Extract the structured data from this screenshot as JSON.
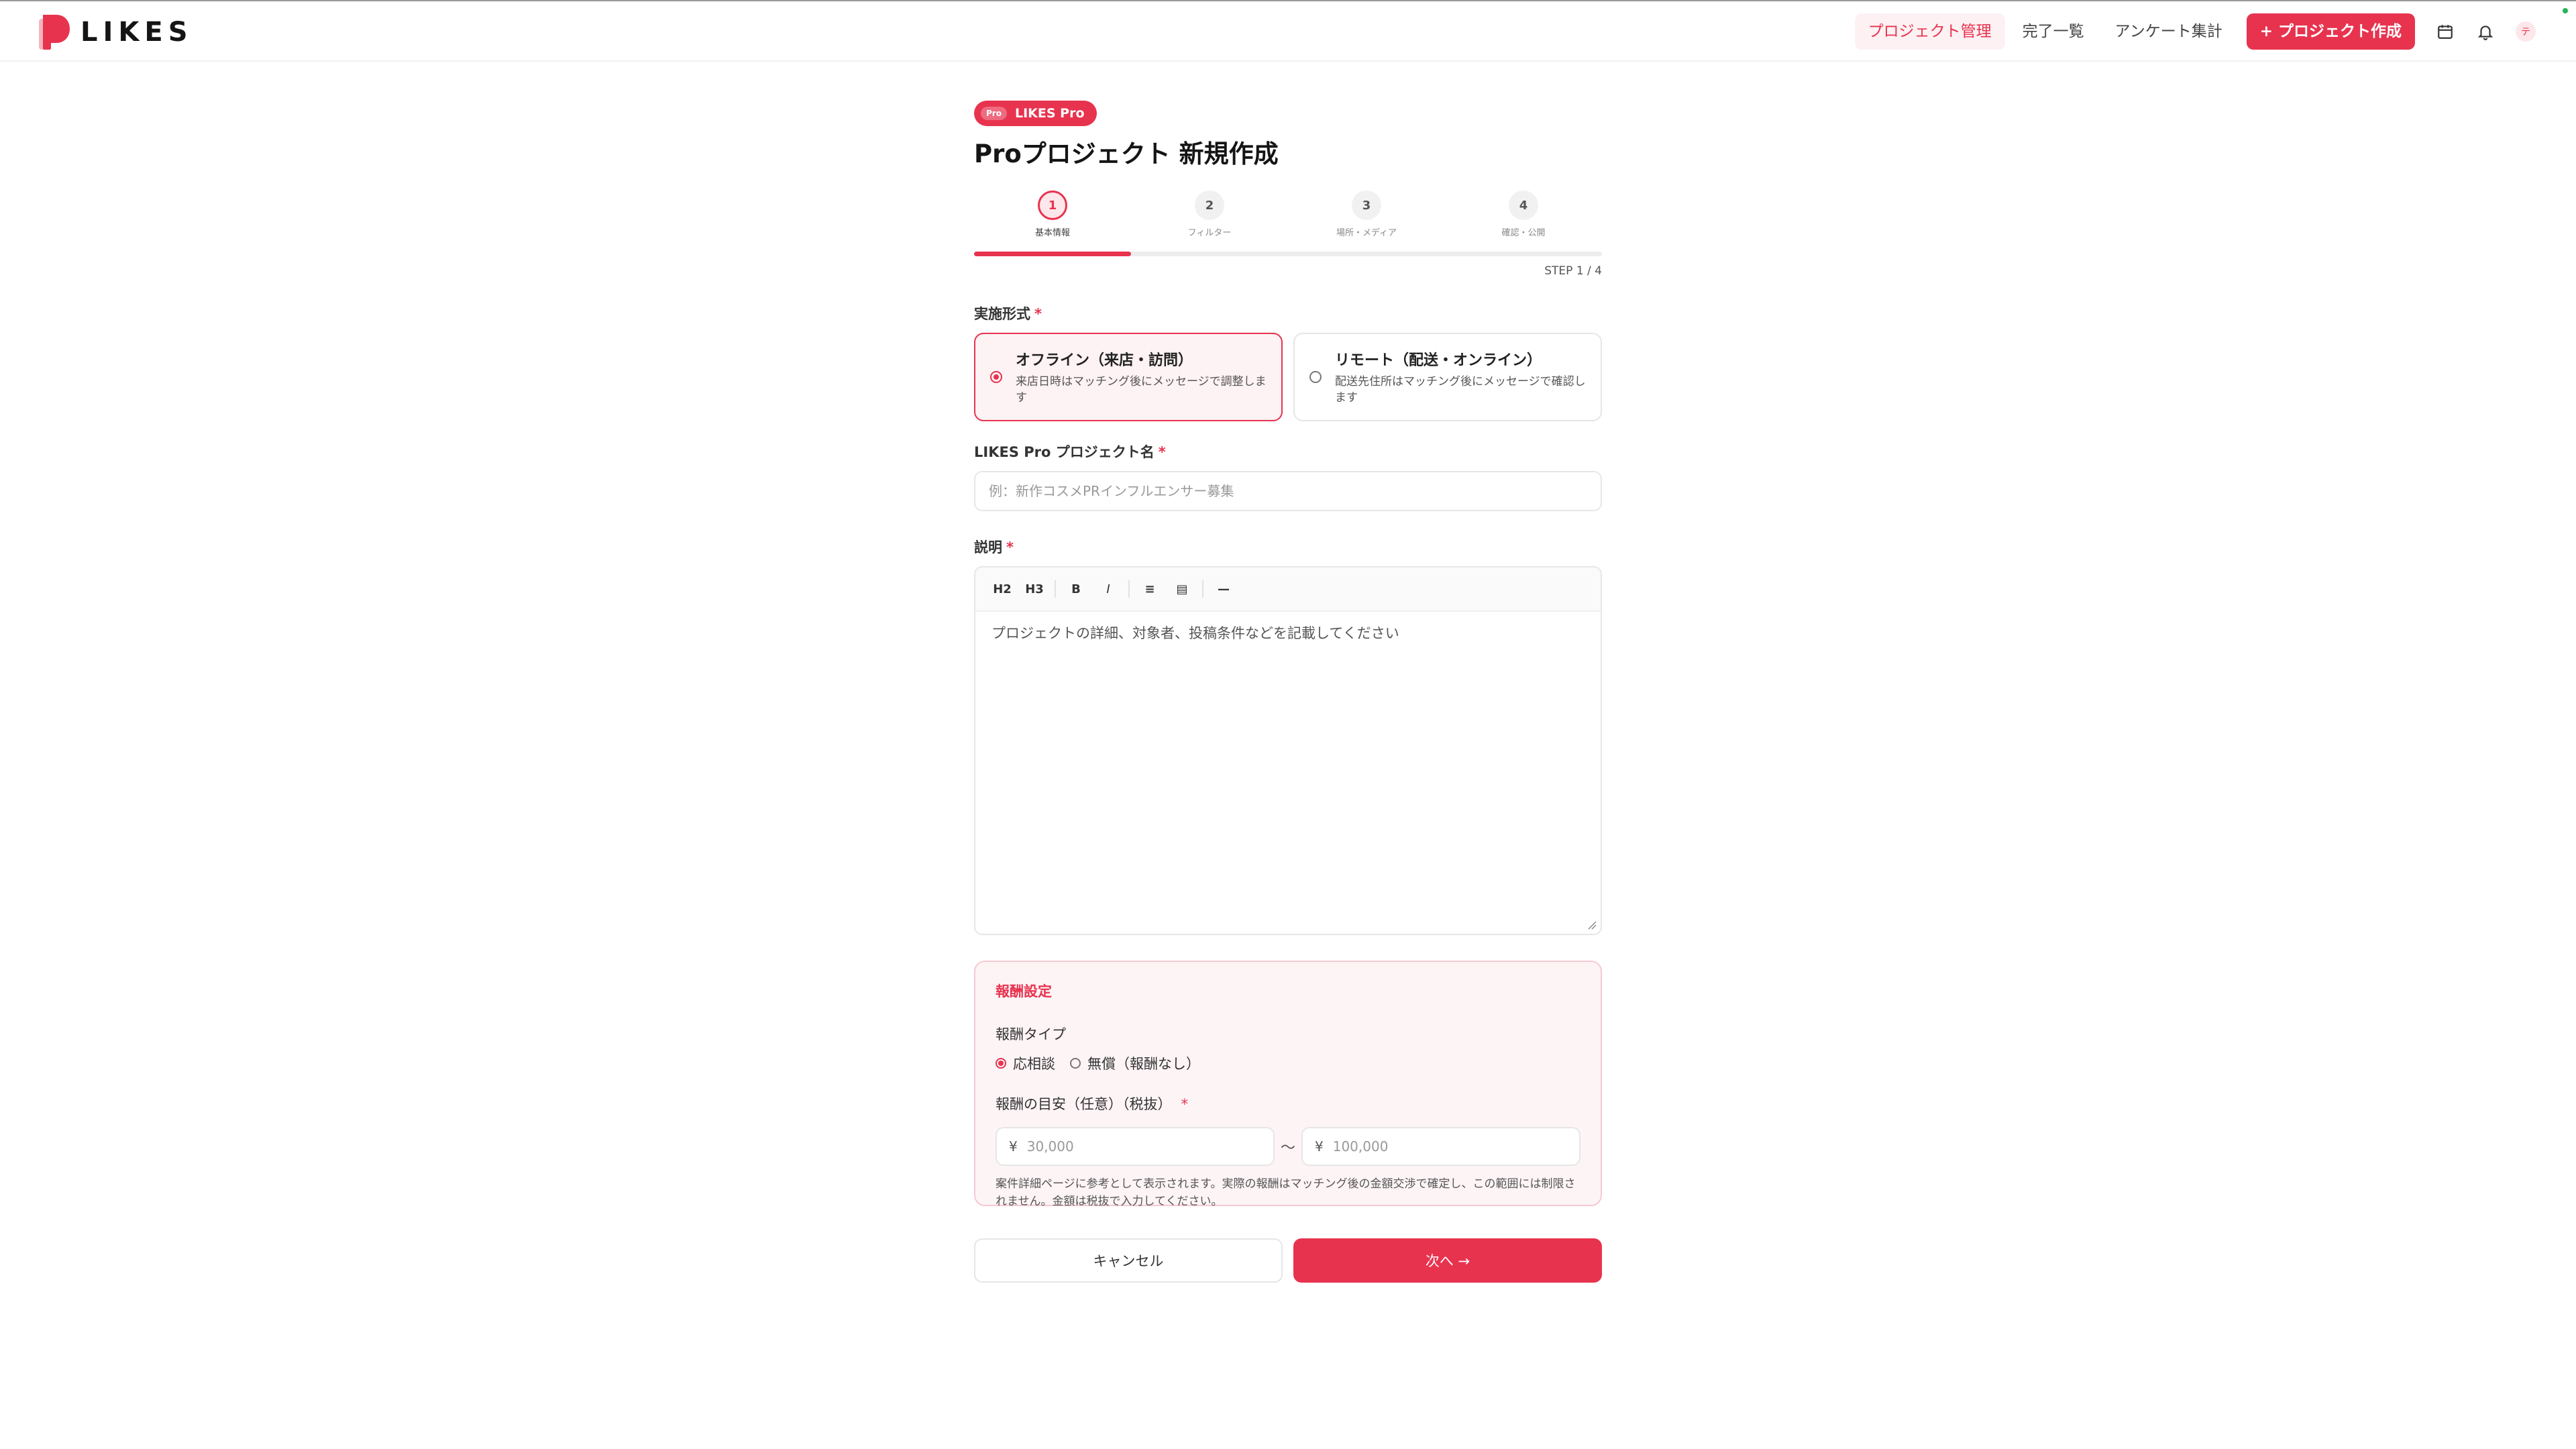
{
  "brand": {
    "name": "LIKES",
    "accent": "#e8334f"
  },
  "nav": {
    "items": [
      {
        "label": "プロジェクト管理",
        "active": true
      },
      {
        "label": "完了一覧",
        "active": false
      },
      {
        "label": "アンケート集計",
        "active": false
      }
    ],
    "create_label": "+ プロジェクト作成",
    "icons": [
      "calendar-icon",
      "bell-icon"
    ],
    "avatar_initial": "テ"
  },
  "page": {
    "badge_mini": "Pro",
    "badge_label": "LIKES Pro",
    "title": "Proプロジェクト 新規作成"
  },
  "stepper": {
    "steps": [
      {
        "number": "1",
        "label": "基本情報"
      },
      {
        "number": "2",
        "label": "フィルター"
      },
      {
        "number": "3",
        "label": "場所・メディア"
      },
      {
        "number": "4",
        "label": "確認・公開"
      }
    ],
    "current": 1,
    "progress": 0.25,
    "count_text": "STEP 1 / 4"
  },
  "form": {
    "format": {
      "label": "実施形式",
      "required": "*",
      "options": [
        {
          "title": "オフライン（来店・訪問）",
          "desc": "来店日時はマッチング後にメッセージで調整します",
          "selected": true
        },
        {
          "title": "リモート（配送・オンライン）",
          "desc": "配送先住所はマッチング後にメッセージで確認します",
          "selected": false
        }
      ]
    },
    "project_name": {
      "label": "LIKES Pro プロジェクト名",
      "required": "*",
      "placeholder": "例：新作コスメPRインフルエンサー募集"
    },
    "description": {
      "label": "説明",
      "required": "*",
      "toolbar": [
        "H2",
        "H3",
        "B",
        "I",
        "≡",
        "▤",
        "—"
      ],
      "placeholder": "プロジェクトの詳細、対象者、投稿条件などを記載してください"
    },
    "reward": {
      "title": "報酬設定",
      "type_label": "報酬タイプ",
      "types": [
        {
          "label": "応相談",
          "selected": true
        },
        {
          "label": "無償（報酬なし）",
          "selected": false
        }
      ],
      "range_label": "報酬の目安（任意）（税抜）",
      "required": "*",
      "currency": "¥",
      "min_placeholder": "30,000",
      "max_placeholder": "100,000",
      "separator": "〜",
      "note": "案件詳細ページに参考として表示されます。実際の報酬はマッチング後の金額交渉で確定し、この範囲には制限されません。金額は税抜で入力してください。"
    }
  },
  "actions": {
    "cancel": "キャンセル",
    "next": "次へ →"
  }
}
